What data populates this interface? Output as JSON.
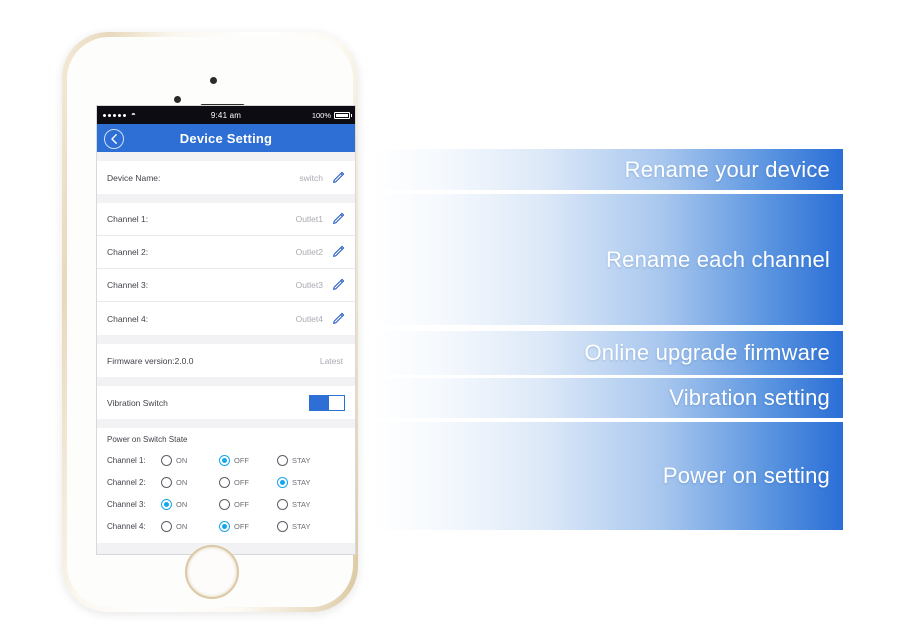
{
  "phone": {
    "status_bar": {
      "signal_dots": 5,
      "wifi_icon": "wifi-icon",
      "time": "9:41 am",
      "battery_percent": "100%",
      "battery_icon": "battery-full-icon"
    },
    "nav": {
      "back_icon": "chevron-left-icon",
      "title": "Device Setting"
    },
    "device_row": {
      "label": "Device Name:",
      "value": "switch",
      "edit_icon": "pencil-icon"
    },
    "channels": [
      {
        "label": "Channel 1:",
        "value": "Outlet1",
        "edit_icon": "pencil-icon"
      },
      {
        "label": "Channel 2:",
        "value": "Outlet2",
        "edit_icon": "pencil-icon"
      },
      {
        "label": "Channel 3:",
        "value": "Outlet3",
        "edit_icon": "pencil-icon"
      },
      {
        "label": "Channel 4:",
        "value": "Outlet4",
        "edit_icon": "pencil-icon"
      }
    ],
    "firmware": {
      "label": "Firmware version:2.0.0",
      "status": "Latest"
    },
    "vibration": {
      "label": "Vibration Switch",
      "state": "on"
    },
    "power_on": {
      "title": "Power on Switch State",
      "options": [
        "ON",
        "OFF",
        "STAY"
      ],
      "rows": [
        {
          "label": "Channel 1:",
          "selected": "OFF"
        },
        {
          "label": "Channel 2:",
          "selected": "STAY"
        },
        {
          "label": "Channel 3:",
          "selected": "ON"
        },
        {
          "label": "Channel 4:",
          "selected": "OFF"
        }
      ]
    }
  },
  "banners": [
    {
      "text": "Rename your device"
    },
    {
      "text": "Rename each channel"
    },
    {
      "text": "Online upgrade firmware"
    },
    {
      "text": "Vibration setting"
    },
    {
      "text": "Power on setting"
    }
  ],
  "colors": {
    "nav_blue": "#2d6fd4",
    "banner_blue": "#2a6ed6",
    "radio_active": "#16a6f0",
    "pencil_blue": "#2b5fc4",
    "background": "#ffffff"
  }
}
